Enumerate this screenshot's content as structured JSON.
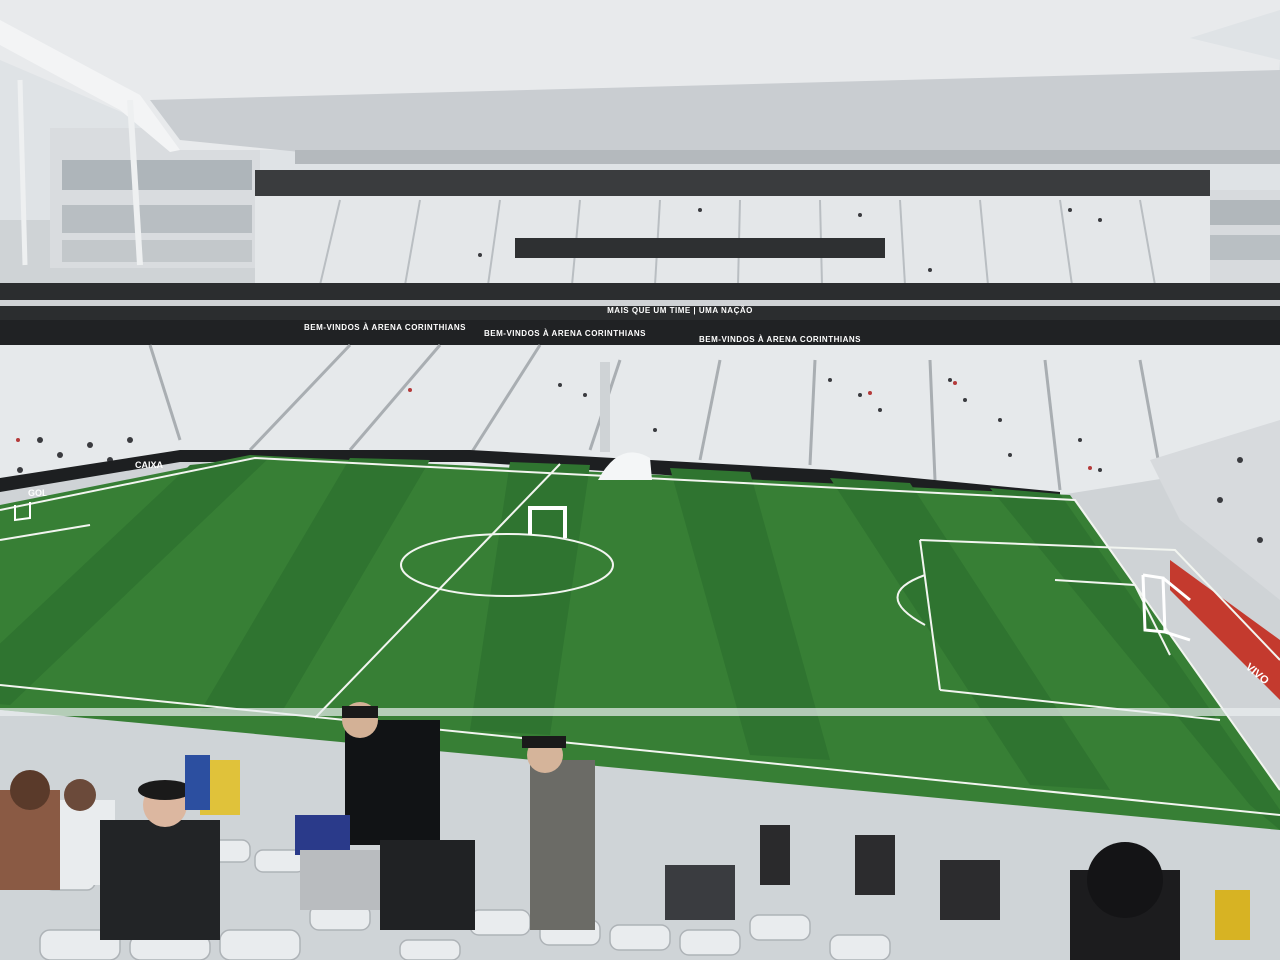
{
  "scene": {
    "description_free": true,
    "colors": {
      "sky": "#dfe3e6",
      "roof": "#e9ecee",
      "roof_under": "#c9cdd0",
      "seats": "#e4e7e9",
      "seat_shadow": "#b9bec2",
      "stand_band": "#2b2d2f",
      "grass_light": "#3f8a3a",
      "grass_dark": "#2f7430",
      "lines": "#f2f5f0",
      "ad_board": "#1d1f21",
      "tunnel_tent": "#f4f6f7"
    }
  },
  "banners": {
    "upper_motto": "MAIS QUE UM TIME | UMA NAÇÃO",
    "welcome_1": "BEM-VINDOS À ARENA CORINTHIANS",
    "welcome_2": "BEM-VINDOS À ARENA CORINTHIANS",
    "welcome_3": "BEM-VINDOS À ARENA CORINTHIANS"
  },
  "ad_boards": {
    "left_caixa": "CAIXA",
    "left_gol": "GOL",
    "right_vivo": "VIVO"
  }
}
